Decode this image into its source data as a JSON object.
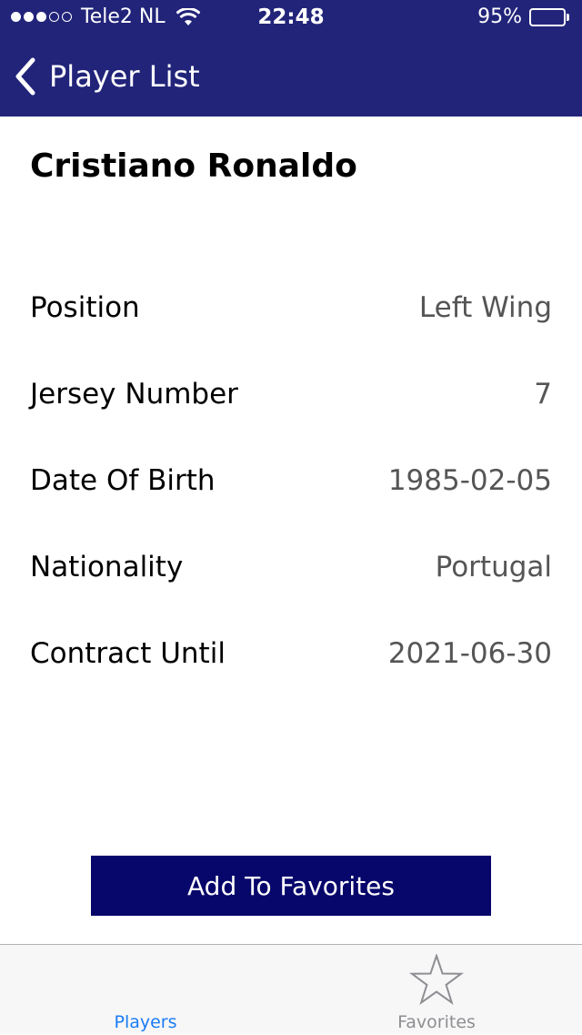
{
  "status_bar": {
    "carrier": "Tele2 NL",
    "time": "22:48",
    "battery_percent": "95%",
    "battery_level": 0.95,
    "signal_strength": 3,
    "signal_max": 5
  },
  "nav": {
    "back_label": "Player List",
    "bar_color": "#22247a"
  },
  "player": {
    "name": "Cristiano Ronaldo",
    "details": [
      {
        "label": "Position",
        "value": "Left Wing"
      },
      {
        "label": "Jersey Number",
        "value": "7"
      },
      {
        "label": "Date Of Birth",
        "value": "1985-02-05"
      },
      {
        "label": "Nationality",
        "value": "Portugal"
      },
      {
        "label": "Contract Until",
        "value": "2021-06-30"
      }
    ]
  },
  "actions": {
    "add_favorite_label": "Add To Favorites",
    "button_color": "#06066b"
  },
  "tab_bar": {
    "tabs": [
      {
        "label": "Players",
        "icon": "players-icon",
        "selected": true
      },
      {
        "label": "Favorites",
        "icon": "star-icon",
        "selected": false
      }
    ],
    "active_color": "#1a7cf5",
    "inactive_color": "#8e8e93"
  }
}
